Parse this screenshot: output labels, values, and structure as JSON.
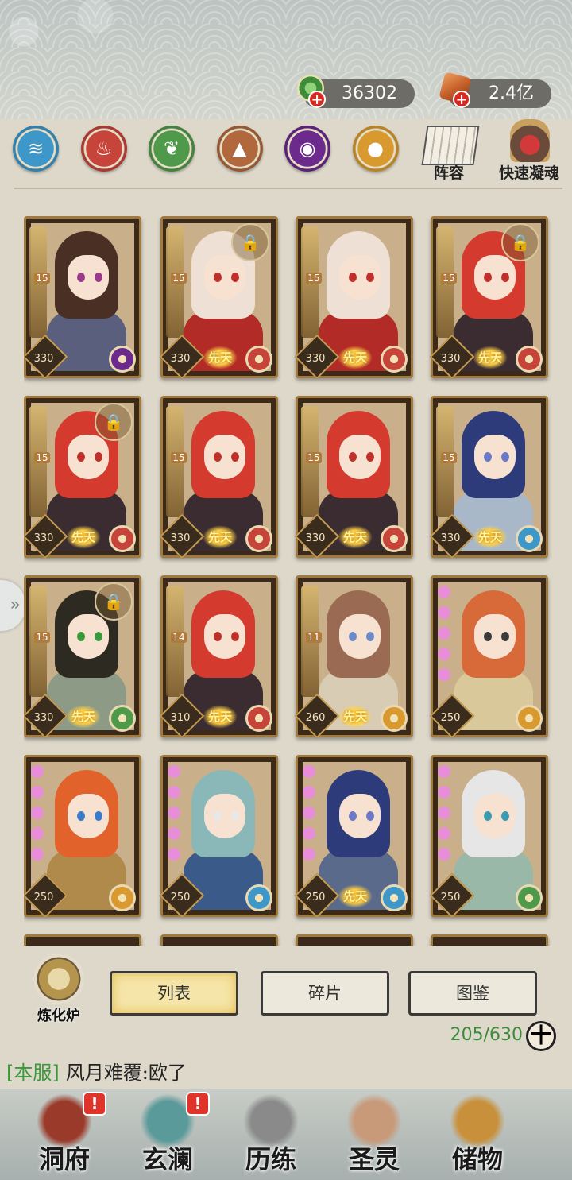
{
  "currency": {
    "jade": {
      "value": "36302",
      "icon": "jade-coin-icon",
      "color": "#3f8c3a"
    },
    "ore": {
      "value": "2.4亿",
      "icon": "ore-crystal-icon",
      "color": "#c8612c"
    }
  },
  "elements": [
    {
      "name": "water-element-icon",
      "color": "#3d98c9",
      "glyph": "≋"
    },
    {
      "name": "fire-element-icon",
      "color": "#c7443a",
      "glyph": "♨"
    },
    {
      "name": "wood-element-icon",
      "color": "#4f9a4a",
      "glyph": "❦"
    },
    {
      "name": "earth-element-icon",
      "color": "#b0683c",
      "glyph": "▲"
    },
    {
      "name": "dark-element-icon",
      "color": "#6b2a8c",
      "glyph": "◉"
    },
    {
      "name": "light-element-icon",
      "color": "#d89a2e",
      "glyph": "●"
    }
  ],
  "side_buttons": {
    "lineup": "阵容",
    "quick_soul": "快速凝魂"
  },
  "cards": [
    {
      "level": "15",
      "power": "330",
      "element_color": "#6b2a8c",
      "hair": "#4a2f24",
      "eye": "#9a3a8a",
      "body": "#5b5f7e",
      "locked": false,
      "xiantian": false,
      "stars": 0
    },
    {
      "level": "15",
      "power": "330",
      "element_color": "#c7443a",
      "hair": "#efe0d6",
      "eye": "#c0302a",
      "body": "#b22b26",
      "locked": true,
      "xiantian": true,
      "stars": 0
    },
    {
      "level": "15",
      "power": "330",
      "element_color": "#c7443a",
      "hair": "#efe0d6",
      "eye": "#c0302a",
      "body": "#b22b26",
      "locked": false,
      "xiantian": true,
      "stars": 0
    },
    {
      "level": "15",
      "power": "330",
      "element_color": "#c7443a",
      "hair": "#d43a2e",
      "eye": "#c0302a",
      "body": "#3a2c30",
      "locked": true,
      "xiantian": true,
      "stars": 0
    },
    {
      "level": "15",
      "power": "330",
      "element_color": "#c7443a",
      "hair": "#d43a2e",
      "eye": "#c0302a",
      "body": "#3a2c30",
      "locked": true,
      "xiantian": true,
      "stars": 0
    },
    {
      "level": "15",
      "power": "330",
      "element_color": "#c7443a",
      "hair": "#d43a2e",
      "eye": "#c0302a",
      "body": "#3a2c30",
      "locked": false,
      "xiantian": true,
      "stars": 0
    },
    {
      "level": "15",
      "power": "330",
      "element_color": "#c7443a",
      "hair": "#d43a2e",
      "eye": "#c0302a",
      "body": "#3a2c30",
      "locked": false,
      "xiantian": true,
      "stars": 0
    },
    {
      "level": "15",
      "power": "330",
      "element_color": "#3d98c9",
      "hair": "#2e3b7a",
      "eye": "#6a78c8",
      "body": "#a9b8c9",
      "locked": false,
      "xiantian": true,
      "stars": 0
    },
    {
      "level": "15",
      "power": "330",
      "element_color": "#4f9a4a",
      "hair": "#2d2a22",
      "eye": "#3a9a3a",
      "body": "#8c9a86",
      "locked": true,
      "xiantian": true,
      "stars": 0
    },
    {
      "level": "14",
      "power": "310",
      "element_color": "#c7443a",
      "hair": "#d43a2e",
      "eye": "#c0302a",
      "body": "#3a2c30",
      "locked": false,
      "xiantian": true,
      "stars": 0
    },
    {
      "level": "11",
      "power": "260",
      "element_color": "#d89a2e",
      "hair": "#9a6a52",
      "eye": "#6a8ac8",
      "body": "#d8ccb4",
      "locked": false,
      "xiantian": true,
      "stars": 0
    },
    {
      "level": "",
      "power": "250",
      "element_color": "#d89a2e",
      "hair": "#d86a3a",
      "eye": "#3a3a3a",
      "body": "#d8c89a",
      "locked": false,
      "xiantian": false,
      "stars": 5
    },
    {
      "level": "",
      "power": "250",
      "element_color": "#d89a2e",
      "hair": "#e2622c",
      "eye": "#3a7aca",
      "body": "#b08a4a",
      "locked": false,
      "xiantian": false,
      "stars": 5
    },
    {
      "level": "",
      "power": "250",
      "element_color": "#3d98c9",
      "hair": "#8ab8b8",
      "eye": "#e8e8e8",
      "body": "#3a5a8a",
      "locked": false,
      "xiantian": false,
      "stars": 5
    },
    {
      "level": "",
      "power": "250",
      "element_color": "#3d98c9",
      "hair": "#2e3b7a",
      "eye": "#6a78c8",
      "body": "#5a6a8a",
      "locked": false,
      "xiantian": true,
      "stars": 5
    },
    {
      "level": "",
      "power": "250",
      "element_color": "#4f9a4a",
      "hair": "#e6e6e6",
      "eye": "#3a9ab0",
      "body": "#9ab8a8",
      "locked": false,
      "xiantian": false,
      "stars": 5
    }
  ],
  "xiantian_label": "先天",
  "furnace_label": "炼化炉",
  "tabs": {
    "list": "列表",
    "fragments": "碎片",
    "atlas": "图鉴"
  },
  "capacity": "205/630",
  "add_symbol": "十",
  "chat": {
    "tag": "[本服]",
    "message": "风月难覆:欧了"
  },
  "nav": [
    {
      "label": "洞府",
      "alert": true,
      "color": "#9a3a2a"
    },
    {
      "label": "玄澜",
      "alert": true,
      "color": "#5a9a9a"
    },
    {
      "label": "历练",
      "alert": false,
      "color": "#8a8a8a"
    },
    {
      "label": "圣灵",
      "alert": false,
      "color": "#c89a7a"
    },
    {
      "label": "储物",
      "alert": false,
      "color": "#c8903a"
    }
  ]
}
